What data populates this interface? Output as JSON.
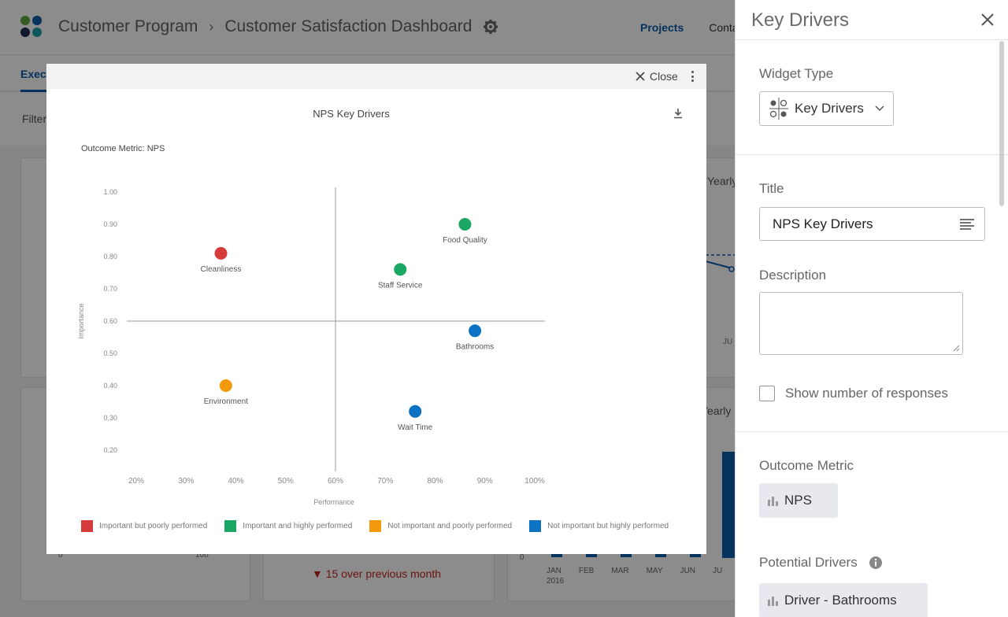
{
  "app": {
    "breadcrumb": [
      "Customer Program",
      "Customer Satisfaction Dashboard"
    ],
    "breadcrumb_separator": "›",
    "nav": [
      "Projects",
      "Conta"
    ],
    "tab_active": "Execu",
    "filter_label": "Filter",
    "bg_yearly_1": "Yearly",
    "bg_yearly_2": "Yearly",
    "bg_months": [
      "JAN",
      "FEB",
      "MAR",
      "MAY",
      "JUN",
      "JU"
    ],
    "bg_year": "2016",
    "bg_axis_left": [
      "0",
      "100"
    ],
    "bg_axis_zero": "0",
    "bg_ju": "JU",
    "bg_trend": "15 over previous month",
    "logo_colors": [
      "#5ea63f",
      "#0b5cab",
      "#1f2a55",
      "#1aa3a8"
    ]
  },
  "modal": {
    "close_label": "Close",
    "outcome_label": "Outcome Metric: NPS"
  },
  "chart_data": {
    "type": "scatter",
    "title": "NPS Key Drivers",
    "xlabel": "Performance",
    "ylabel": "Importance",
    "xlim": [
      20,
      100
    ],
    "ylim": [
      0.2,
      1.0
    ],
    "x_ticks": [
      "20%",
      "30%",
      "40%",
      "50%",
      "60%",
      "70%",
      "80%",
      "90%",
      "100%"
    ],
    "y_ticks": [
      "1.00",
      "0.90",
      "0.80",
      "0.70",
      "0.60",
      "0.50",
      "0.40",
      "0.30",
      "0.20"
    ],
    "quadrant_x": 60,
    "quadrant_y": 0.6,
    "points": [
      {
        "label": "Cleanliness",
        "x": 37,
        "y": 0.81,
        "category": 0
      },
      {
        "label": "Food Quality",
        "x": 86,
        "y": 0.9,
        "category": 1
      },
      {
        "label": "Staff Service",
        "x": 73,
        "y": 0.76,
        "category": 1
      },
      {
        "label": "Bathrooms",
        "x": 88,
        "y": 0.57,
        "category": 3
      },
      {
        "label": "Environment",
        "x": 38,
        "y": 0.4,
        "category": 2
      },
      {
        "label": "Wait Time",
        "x": 76,
        "y": 0.32,
        "category": 3
      }
    ],
    "legend": [
      {
        "label": "Important but poorly performed",
        "color": "#d63b3b"
      },
      {
        "label": "Important and highly performed",
        "color": "#1aa664"
      },
      {
        "label": "Not important and poorly performed",
        "color": "#f29a0c"
      },
      {
        "label": "Not important but highly performed",
        "color": "#0b72c4"
      }
    ]
  },
  "panel": {
    "title": "Key Drivers",
    "widget_type_label": "Widget Type",
    "widget_type_value": "Key Drivers",
    "title_label": "Title",
    "title_value": "NPS Key Drivers",
    "description_label": "Description",
    "show_responses_label": "Show number of responses",
    "outcome_metric_label": "Outcome Metric",
    "outcome_metric_value": "NPS",
    "potential_drivers_label": "Potential Drivers",
    "driver_value": "Driver - Bathrooms"
  }
}
